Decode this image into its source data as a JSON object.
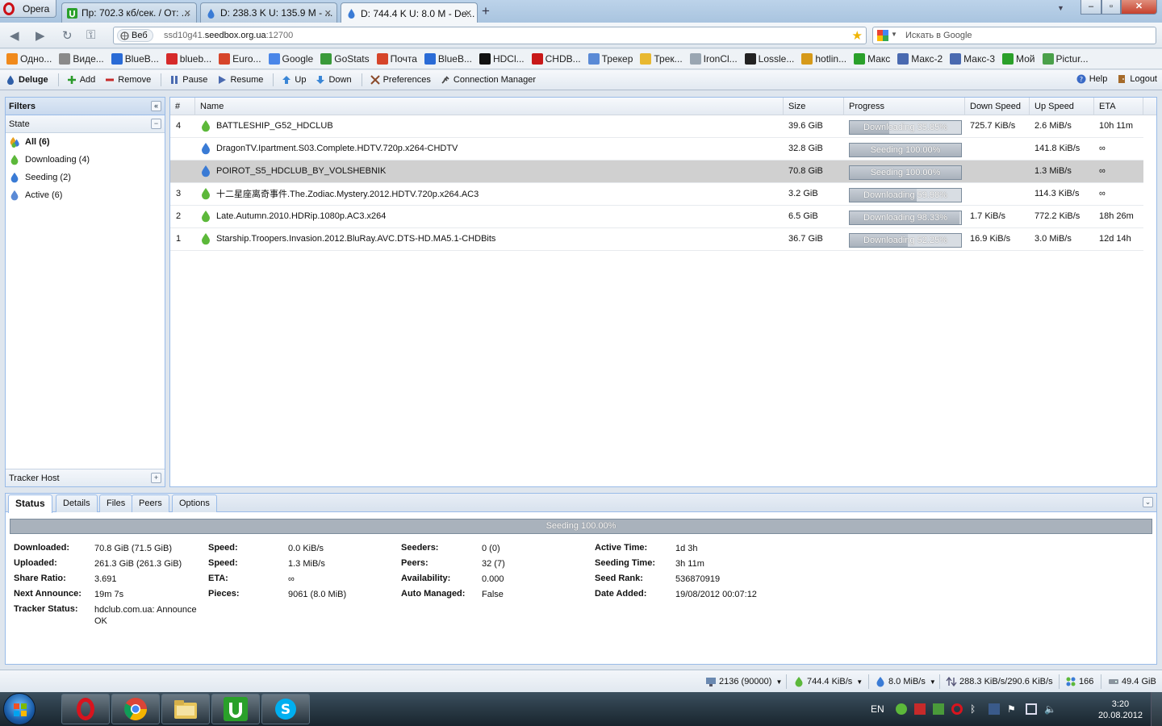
{
  "browser": {
    "menu_label": "Opera",
    "tabs": [
      {
        "title": "Пр: 702.3 кб/сек. / От: ...",
        "active": false
      },
      {
        "title": "D: 238.3 K U: 135.9 M - ...",
        "active": false
      },
      {
        "title": "D: 744.4 K U: 8.0 M - De...",
        "active": true
      }
    ],
    "new_tab": "+",
    "address": {
      "badge": "Веб",
      "url_prefix": "ssd10g41.",
      "url_host": "seedbox.org.ua",
      "url_suffix": ":12700"
    },
    "search_placeholder": "Искать в Google"
  },
  "bookmarks": [
    {
      "label": "Одно...",
      "color": "#f08a1c"
    },
    {
      "label": "Виде...",
      "color": "#8a8a8a"
    },
    {
      "label": "BlueB...",
      "color": "#2a6bd6"
    },
    {
      "label": "blueb...",
      "color": "#d62a2a"
    },
    {
      "label": "Euro...",
      "color": "#d6452a"
    },
    {
      "label": "Google",
      "color": "#4a86e8"
    },
    {
      "label": "GoStats",
      "color": "#3a9a3a"
    },
    {
      "label": "Почта",
      "color": "#d6452a"
    },
    {
      "label": "BlueB...",
      "color": "#2a6bd6"
    },
    {
      "label": "HDCl...",
      "color": "#111111"
    },
    {
      "label": "CHDB...",
      "color": "#c81818"
    },
    {
      "label": "Трекер",
      "color": "#5a8ad6"
    },
    {
      "label": "Трек...",
      "color": "#e8b830"
    },
    {
      "label": "IronCl...",
      "color": "#9aa6b2"
    },
    {
      "label": "Lossle...",
      "color": "#222222"
    },
    {
      "label": "hotlin...",
      "color": "#d69a1a"
    },
    {
      "label": "Макс",
      "color": "#2aa02a"
    },
    {
      "label": "Макс-2",
      "color": "#4a6ab0"
    },
    {
      "label": "Макс-3",
      "color": "#4a6ab0"
    },
    {
      "label": "Мой",
      "color": "#2aa02a"
    },
    {
      "label": "Pictur...",
      "color": "#4aa04a"
    }
  ],
  "toolbar": {
    "app_name": "Deluge",
    "add": "Add",
    "remove": "Remove",
    "pause": "Pause",
    "resume": "Resume",
    "up": "Up",
    "down": "Down",
    "preferences": "Preferences",
    "connection_manager": "Connection Manager",
    "help": "Help",
    "logout": "Logout"
  },
  "filters": {
    "title": "Filters",
    "state_title": "State",
    "items": [
      {
        "label": "All (6)",
        "selected": true
      },
      {
        "label": "Downloading (4)",
        "selected": false
      },
      {
        "label": "Seeding (2)",
        "selected": false
      },
      {
        "label": "Active (6)",
        "selected": false
      }
    ],
    "tracker_host": "Tracker Host"
  },
  "grid": {
    "columns": [
      "#",
      "Name",
      "Size",
      "Progress",
      "Down Speed",
      "Up Speed",
      "ETA"
    ],
    "rows": [
      {
        "num": "4",
        "name": "BATTLESHIP_G52_HDCLUB",
        "size": "39.6 GiB",
        "state": "downloading",
        "progress_text": "Downloading 35.85%",
        "progress": 35.85,
        "down": "725.7 KiB/s",
        "up": "2.6 MiB/s",
        "eta": "10h 11m",
        "selected": false
      },
      {
        "num": "",
        "name": "DragonTV.Ipartment.S03.Complete.HDTV.720p.x264-CHDTV",
        "size": "32.8 GiB",
        "state": "seeding",
        "progress_text": "Seeding 100.00%",
        "progress": 100,
        "down": "",
        "up": "141.8 KiB/s",
        "eta": "∞",
        "selected": false
      },
      {
        "num": "",
        "name": "POIROT_S5_HDCLUB_BY_VOLSHEBNIK",
        "size": "70.8 GiB",
        "state": "seeding",
        "progress_text": "Seeding 100.00%",
        "progress": 100,
        "down": "",
        "up": "1.3 MiB/s",
        "eta": "∞",
        "selected": true
      },
      {
        "num": "3",
        "name": "十二星座离奇事件.The.Zodiac.Mystery.2012.HDTV.720p.x264.AC3",
        "size": "3.2 GiB",
        "state": "downloading",
        "progress_text": "Downloading 59.98%",
        "progress": 59.98,
        "down": "",
        "up": "114.3 KiB/s",
        "eta": "∞",
        "selected": false
      },
      {
        "num": "2",
        "name": "Late.Autumn.2010.HDRip.1080p.AC3.x264",
        "size": "6.5 GiB",
        "state": "downloading",
        "progress_text": "Downloading 98.33%",
        "progress": 98.33,
        "down": "1.7 KiB/s",
        "up": "772.2 KiB/s",
        "eta": "18h 26m",
        "selected": false
      },
      {
        "num": "1",
        "name": "Starship.Troopers.Invasion.2012.BluRay.AVC.DTS-HD.MA5.1-CHDBits",
        "size": "36.7 GiB",
        "state": "downloading",
        "progress_text": "Downloading 52.25%",
        "progress": 52.25,
        "down": "16.9 KiB/s",
        "up": "3.0 MiB/s",
        "eta": "12d 14h",
        "selected": false
      }
    ]
  },
  "details": {
    "tabs": [
      {
        "label": "Status",
        "active": true
      },
      {
        "label": "Details",
        "active": false
      },
      {
        "label": "Files",
        "active": false
      },
      {
        "label": "Peers",
        "active": false
      },
      {
        "label": "Options",
        "active": false
      }
    ],
    "progress_text": "Seeding 100.00%",
    "progress": 100,
    "col1": [
      {
        "label": "Downloaded:",
        "value": "70.8 GiB (71.5 GiB)"
      },
      {
        "label": "Uploaded:",
        "value": "261.3 GiB (261.3 GiB)"
      },
      {
        "label": "Share Ratio:",
        "value": "3.691"
      },
      {
        "label": "Next Announce:",
        "value": "19m 7s"
      },
      {
        "label": "Tracker Status:",
        "value": "hdclub.com.ua: Announce OK"
      }
    ],
    "col2": [
      {
        "label": "Speed:",
        "value": "0.0 KiB/s"
      },
      {
        "label": "Speed:",
        "value": "1.3 MiB/s"
      },
      {
        "label": "ETA:",
        "value": "∞"
      },
      {
        "label": "Pieces:",
        "value": "9061 (8.0 MiB)"
      }
    ],
    "col3": [
      {
        "label": "Seeders:",
        "value": "0 (0)"
      },
      {
        "label": "Peers:",
        "value": "32 (7)"
      },
      {
        "label": "Availability:",
        "value": "0.000"
      },
      {
        "label": "Auto Managed:",
        "value": "False"
      }
    ],
    "col4": [
      {
        "label": "Active Time:",
        "value": "1d 3h"
      },
      {
        "label": "Seeding Time:",
        "value": "3h 11m"
      },
      {
        "label": "Seed Rank:",
        "value": "536870919"
      },
      {
        "label": "Date Added:",
        "value": "19/08/2012 00:07:12"
      }
    ]
  },
  "statusbar": {
    "connections": "2136 (90000)",
    "down_speed": "744.4 KiB/s",
    "up_speed": "8.0 MiB/s",
    "protocol": "288.3 KiB/s/290.6 KiB/s",
    "dht": "166",
    "free_space": "49.4 GiB"
  },
  "taskbar": {
    "lang": "EN",
    "time": "3:20",
    "date": "20.08.2012"
  },
  "colors": {
    "panel_border": "#99bbe8",
    "selected_row": "#d0d0d0",
    "download_icon": "#5cb83a",
    "seed_icon": "#3a7bd5"
  }
}
